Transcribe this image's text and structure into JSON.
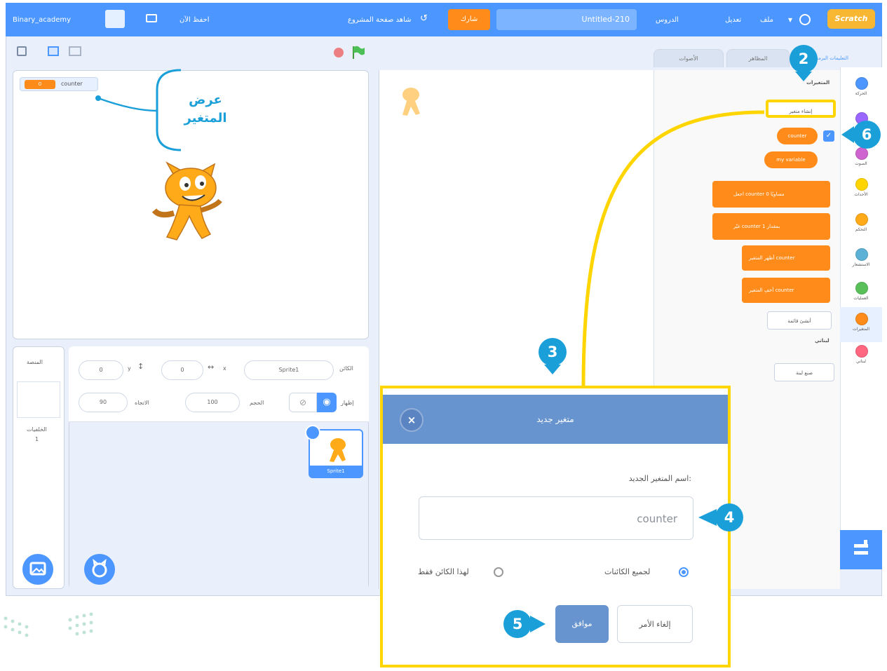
{
  "menubar": {
    "logo": "Scratch",
    "language_menu": "▾",
    "file_menu": "ملف",
    "edit_menu": "تعديل",
    "tutorials": "الدروس",
    "project_title": "Untitled-210",
    "share_button": "شارك",
    "see_project_page": "شاهد صفحة المشروع",
    "save_now": "احفظ الآن",
    "username": "Binary_academy"
  },
  "stage": {
    "variable_monitor": {
      "name": "counter",
      "value": "0"
    }
  },
  "sprite_info": {
    "sprite_label": "الكائن",
    "sprite_name": "Sprite1",
    "x_label": "x",
    "x_value": "0",
    "y_label": "y",
    "y_value": "0",
    "show_label": "إظهار",
    "size_label": "الحجم",
    "size_value": "100",
    "direction_label": "الاتجاه",
    "direction_value": "90",
    "sprite_thumb_name": "Sprite1"
  },
  "stage_pane": {
    "title": "المنصة",
    "backdrops_label": "الخلفيات",
    "backdrops_count": "1"
  },
  "tabs": {
    "code": "التعليمات البرمجية",
    "costumes": "المظاهر",
    "sounds": "الأصوات"
  },
  "palette": {
    "section_title": "المتغيرات",
    "make_variable": "إنشاء متغير",
    "var_block": "counter",
    "var_block_2": "my variable",
    "set_block": "اجعل counter مساويًا 0",
    "change_block": "غيّر counter بمقدار 1",
    "show_var_block": "أظهر المتغير counter",
    "hide_var_block": "أخفِ المتغير counter",
    "make_list": "أنشئ قائمة",
    "my_blocks_title": "لبناتي",
    "make_block": "صنع لبنة"
  },
  "categories": [
    {
      "label": "الحركة",
      "color": "#4c97ff"
    },
    {
      "label": "الهيئة",
      "color": "#9966ff"
    },
    {
      "label": "الصوت",
      "color": "#cf63cf"
    },
    {
      "label": "الأحداث",
      "color": "#ffd500"
    },
    {
      "label": "التحكم",
      "color": "#ffab19"
    },
    {
      "label": "الاستشعار",
      "color": "#5cb1d6"
    },
    {
      "label": "العمليات",
      "color": "#59c059"
    },
    {
      "label": "المتغيرات",
      "color": "#ff8c1a"
    },
    {
      "label": "لبناتي",
      "color": "#ff6680"
    }
  ],
  "callouts": {
    "variable_display": [
      "عرض",
      "المتغير"
    ],
    "step_2": "2",
    "step_3": "3",
    "step_4": "4",
    "step_5": "5",
    "step_6": "6"
  },
  "dialog": {
    "title": "متغير جديد",
    "close": "×",
    "name_label": "اسم المتغير الجديد:",
    "name_value": "counter",
    "for_all_sprites": "لجميع الكائنات",
    "for_this_sprite_only": "لهذا الكائن فقط",
    "ok": "موافق",
    "cancel": "إلغاء الأمر"
  },
  "colors": {
    "scratch_blue": "#4c97ff",
    "variables_orange": "#ff8c1a",
    "highlight_yellow": "#ffd500",
    "callout_blue": "#1a9fd9",
    "dialog_header": "#6794cf"
  }
}
